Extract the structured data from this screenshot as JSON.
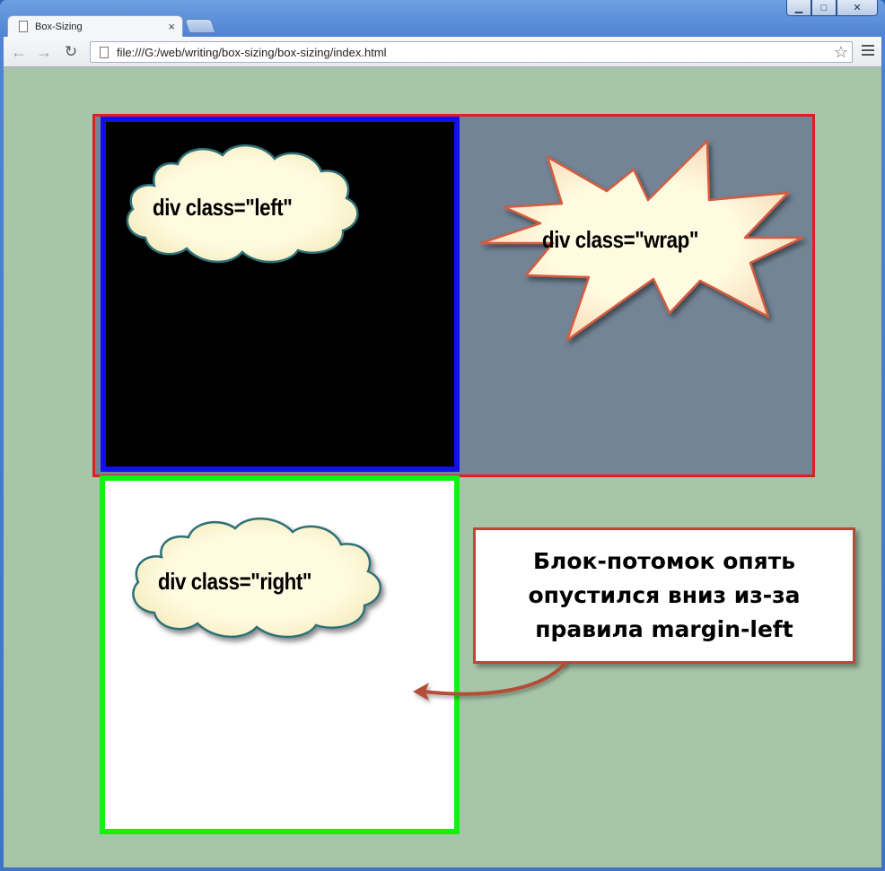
{
  "browser": {
    "tab_title": "Box-Sizing",
    "tab_close": "×",
    "url": "file:///G:/web/writing/box-sizing/box-sizing/index.html",
    "back_icon": "←",
    "forward_icon": "→",
    "reload_icon": "↻",
    "star_icon": "☆",
    "window_buttons": {
      "minimize": "▁",
      "maximize": "□",
      "close": "✕"
    }
  },
  "page": {
    "labels": {
      "left": "div class=\"left\"",
      "wrap": "div class=\"wrap\"",
      "right": "div class=\"right\""
    },
    "note_lines": [
      "Блок-потомок опять",
      "опустился вниз из-за",
      "правила margin-left"
    ],
    "colors": {
      "background": "#a7c5a8",
      "wrap_border": "#e02020",
      "wrap_fill": "#738496",
      "left_border": "#1010ee",
      "left_fill": "#000000",
      "right_border": "#12f212",
      "right_fill": "#ffffff",
      "callout_fill": "#fdf7da",
      "cloud_stroke": "#2f7077",
      "star_stroke": "#d35b3f",
      "note_border": "#b34d39",
      "arrow": "#b34d39"
    }
  }
}
